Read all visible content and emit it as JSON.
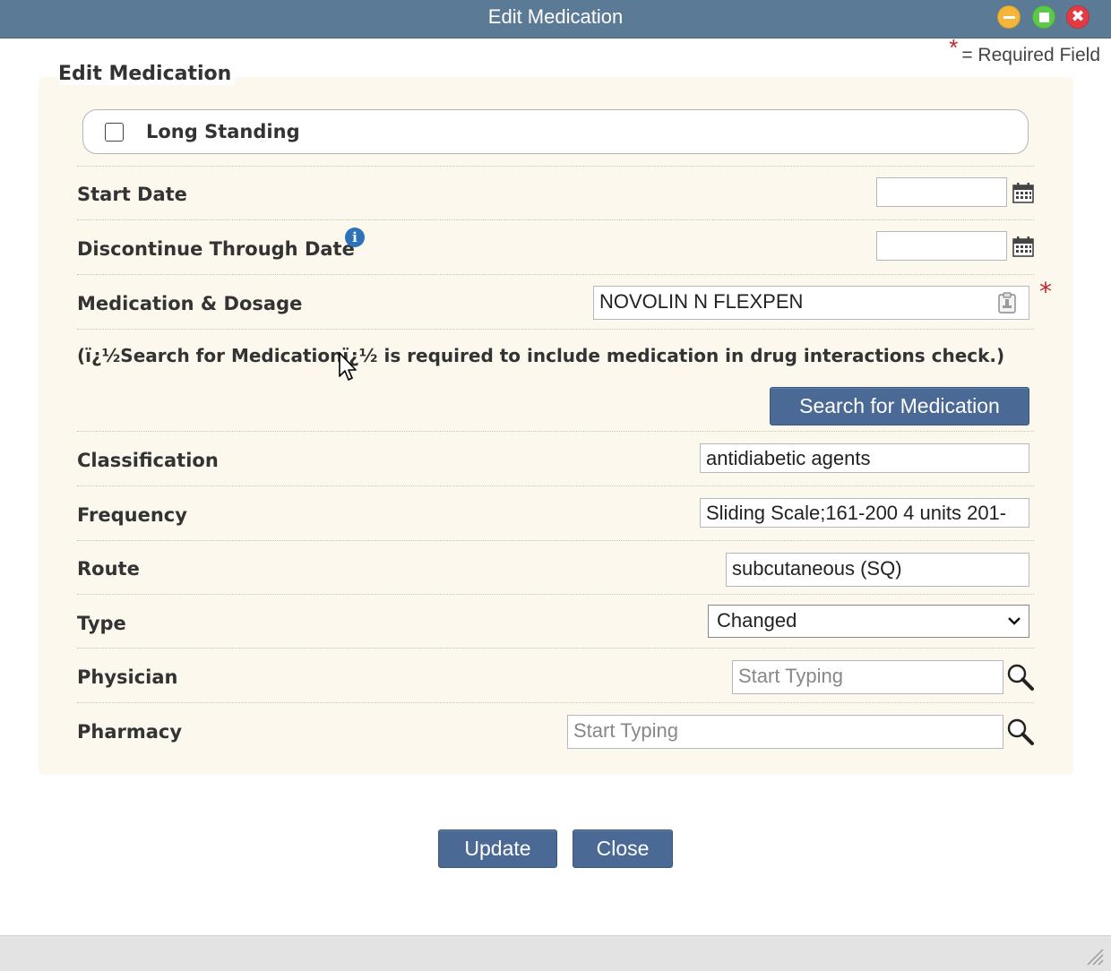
{
  "window": {
    "title": "Edit Medication",
    "buttons": [
      "minimize",
      "maximize",
      "close"
    ],
    "colors": {
      "titlebar": "#5b7a95",
      "minimize": "#f3b53a",
      "maximize": "#5ec84a",
      "close": "#e23b44"
    }
  },
  "required_note": {
    "star": "*",
    "text": "= Required Field"
  },
  "form": {
    "title": "Edit Medication",
    "long_standing": {
      "label": "Long Standing",
      "checked": false
    },
    "start_date": {
      "label": "Start Date",
      "value": ""
    },
    "discontinue_through_date": {
      "label": "Discontinue Through Date",
      "value": ""
    },
    "medication_dosage": {
      "label": "Medication & Dosage",
      "value": "NOVOLIN N FLEXPEN",
      "required_star": "*"
    },
    "note": "(ï¿½Search for Medicationï¿½ is required to include medication in drug interactions check.)",
    "search_button": "Search for Medication",
    "classification": {
      "label": "Classification",
      "value": "antidiabetic agents"
    },
    "frequency": {
      "label": "Frequency",
      "value": "Sliding Scale;161-200 4 units 201-"
    },
    "route": {
      "label": "Route",
      "value": "subcutaneous (SQ)"
    },
    "type": {
      "label": "Type",
      "selected": "Changed"
    },
    "physician": {
      "label": "Physician",
      "placeholder": "Start Typing",
      "value": ""
    },
    "pharmacy": {
      "label": "Pharmacy",
      "placeholder": "Start Typing",
      "value": ""
    }
  },
  "actions": {
    "update": "Update",
    "close": "Close"
  },
  "icons": {
    "calendar": "calendar-icon",
    "info": "info-icon",
    "clipboard": "clipboard-icon",
    "search": "magnifier-icon",
    "dropdown": "chevron-down-icon"
  }
}
